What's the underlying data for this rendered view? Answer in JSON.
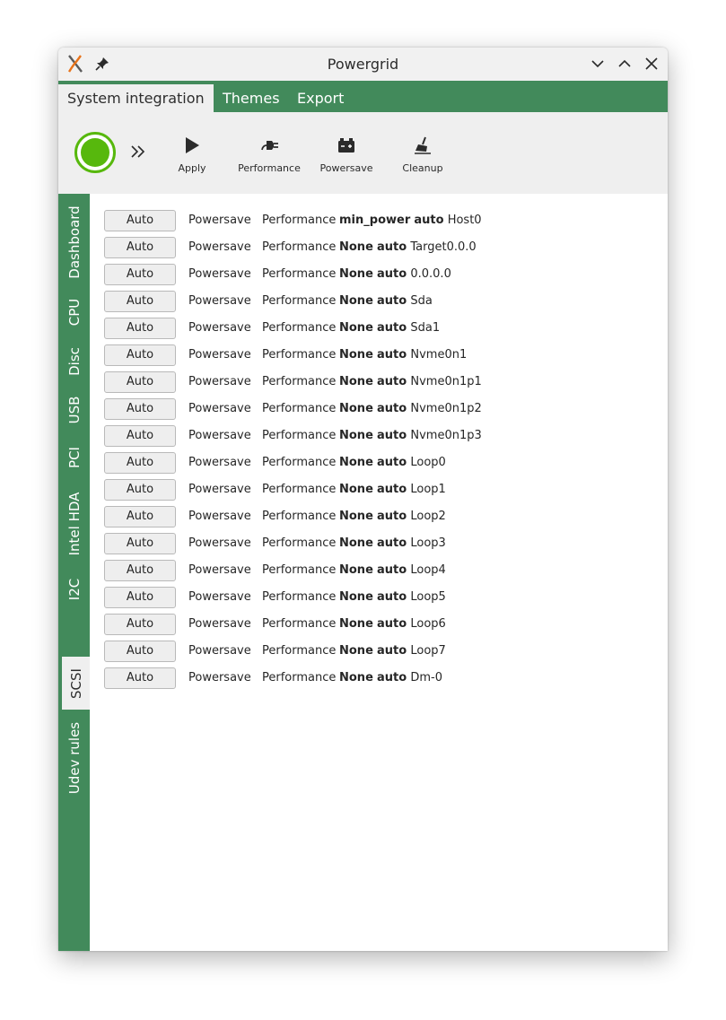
{
  "window": {
    "title": "Powergrid"
  },
  "menu": {
    "tabs": [
      "System integration",
      "Themes",
      "Export"
    ]
  },
  "toolbar": {
    "apply_label": "Apply",
    "performance_label": "Performance",
    "powersave_label": "Powersave",
    "cleanup_label": "Cleanup",
    "status_color": "#57b80d"
  },
  "sidebar": {
    "tabs": [
      "Dashboard",
      "CPU",
      "Disc",
      "USB",
      "PCI",
      "Intel HDA",
      "I2C",
      "SCSI",
      "Udev rules"
    ],
    "active": "SCSI"
  },
  "colors": {
    "accent": "#428a5b",
    "status_green": "#57b80d"
  },
  "rows": [
    {
      "button": "Auto",
      "powersave": "Powersave",
      "performance": "Performance",
      "policy": "min_power",
      "mode": "auto",
      "device": "Host0"
    },
    {
      "button": "Auto",
      "powersave": "Powersave",
      "performance": "Performance",
      "policy": "None",
      "mode": "auto",
      "device": "Target0.0.0"
    },
    {
      "button": "Auto",
      "powersave": "Powersave",
      "performance": "Performance",
      "policy": "None",
      "mode": "auto",
      "device": "0.0.0.0"
    },
    {
      "button": "Auto",
      "powersave": "Powersave",
      "performance": "Performance",
      "policy": "None",
      "mode": "auto",
      "device": "Sda"
    },
    {
      "button": "Auto",
      "powersave": "Powersave",
      "performance": "Performance",
      "policy": "None",
      "mode": "auto",
      "device": "Sda1"
    },
    {
      "button": "Auto",
      "powersave": "Powersave",
      "performance": "Performance",
      "policy": "None",
      "mode": "auto",
      "device": "Nvme0n1"
    },
    {
      "button": "Auto",
      "powersave": "Powersave",
      "performance": "Performance",
      "policy": "None",
      "mode": "auto",
      "device": "Nvme0n1p1"
    },
    {
      "button": "Auto",
      "powersave": "Powersave",
      "performance": "Performance",
      "policy": "None",
      "mode": "auto",
      "device": "Nvme0n1p2"
    },
    {
      "button": "Auto",
      "powersave": "Powersave",
      "performance": "Performance",
      "policy": "None",
      "mode": "auto",
      "device": "Nvme0n1p3"
    },
    {
      "button": "Auto",
      "powersave": "Powersave",
      "performance": "Performance",
      "policy": "None",
      "mode": "auto",
      "device": "Loop0"
    },
    {
      "button": "Auto",
      "powersave": "Powersave",
      "performance": "Performance",
      "policy": "None",
      "mode": "auto",
      "device": "Loop1"
    },
    {
      "button": "Auto",
      "powersave": "Powersave",
      "performance": "Performance",
      "policy": "None",
      "mode": "auto",
      "device": "Loop2"
    },
    {
      "button": "Auto",
      "powersave": "Powersave",
      "performance": "Performance",
      "policy": "None",
      "mode": "auto",
      "device": "Loop3"
    },
    {
      "button": "Auto",
      "powersave": "Powersave",
      "performance": "Performance",
      "policy": "None",
      "mode": "auto",
      "device": "Loop4"
    },
    {
      "button": "Auto",
      "powersave": "Powersave",
      "performance": "Performance",
      "policy": "None",
      "mode": "auto",
      "device": "Loop5"
    },
    {
      "button": "Auto",
      "powersave": "Powersave",
      "performance": "Performance",
      "policy": "None",
      "mode": "auto",
      "device": "Loop6"
    },
    {
      "button": "Auto",
      "powersave": "Powersave",
      "performance": "Performance",
      "policy": "None",
      "mode": "auto",
      "device": "Loop7"
    },
    {
      "button": "Auto",
      "powersave": "Powersave",
      "performance": "Performance",
      "policy": "None",
      "mode": "auto",
      "device": "Dm-0"
    }
  ]
}
